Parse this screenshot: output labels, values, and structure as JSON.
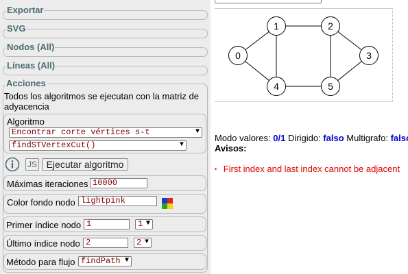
{
  "sections": {
    "exportar": "Exportar",
    "svg": "SVG",
    "nodos": "Nodos (All)",
    "lineas": "Líneas (All)",
    "acciones": "Acciones"
  },
  "acciones": {
    "description": "Todos los algoritmos se ejecutan con la matriz de adyacencia",
    "algoritmo_label": "Algoritmo",
    "algoritmo_select": "Encontrar corte vértices s-t",
    "function_select": "findSTVertexCut()",
    "info_icon": "info-icon",
    "js_button": "JS",
    "ejecutar_button": "Ejecutar algoritmo",
    "max_iter_label": "Máximas iteraciones",
    "max_iter_value": "10000",
    "color_fondo_label": "Color fondo nodo",
    "color_fondo_value": "lightpink",
    "palette_icon": "color-palette-icon",
    "primer_label": "Primer índice nodo",
    "primer_value": "1",
    "primer_select": "1",
    "ultimo_label": "Último índice nodo",
    "ultimo_value": "2",
    "ultimo_select": "2",
    "metodo_label": "Método para flujo",
    "metodo_select": "findPath"
  },
  "graph": {
    "nodes": [
      {
        "id": "0"
      },
      {
        "id": "1"
      },
      {
        "id": "2"
      },
      {
        "id": "3"
      },
      {
        "id": "4"
      },
      {
        "id": "5"
      }
    ],
    "edges": [
      [
        "0",
        "1"
      ],
      [
        "0",
        "4"
      ],
      [
        "1",
        "2"
      ],
      [
        "1",
        "4"
      ],
      [
        "2",
        "5"
      ],
      [
        "2",
        "3"
      ],
      [
        "3",
        "5"
      ],
      [
        "4",
        "5"
      ]
    ]
  },
  "status": {
    "modo_label": "Modo valores:",
    "modo_value": "0/1",
    "dirigido_label": "Dirigido:",
    "dirigido_value": "falso",
    "multigrafo_label": "Multigrafo:",
    "multigrafo_value": "falso",
    "avisos_label": "Avisos:",
    "warning": "First index and last index cannot be adjacent"
  },
  "colors": {
    "legend": "#4c6b72",
    "value_blue": "#0000cc",
    "warning_red": "#e00000",
    "mono_dark_red": "#800000"
  }
}
